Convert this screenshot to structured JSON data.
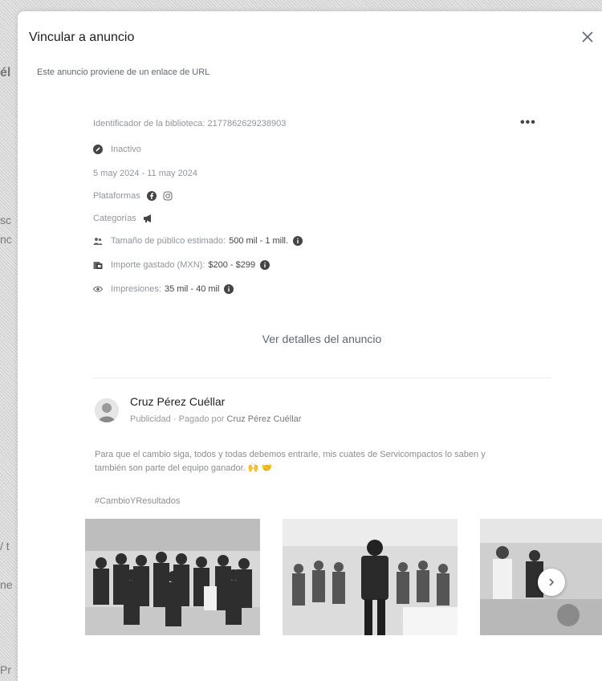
{
  "background": {
    "fragments": [
      "él",
      "sc",
      "nc",
      "/ t",
      "ne",
      "Pr"
    ]
  },
  "modal": {
    "title": "Vincular a anuncio",
    "subtitle": "Este anuncio proviene de un enlace de URL"
  },
  "ad": {
    "library_id_label": "Identificador de la biblioteca: 2177862629238903",
    "status": "Inactivo",
    "date_range": "5 may 2024 - 11 may 2024",
    "platforms_label": "Plataformas",
    "platform_icons": [
      "facebook-icon",
      "instagram-icon"
    ],
    "categories_label": "Categorías",
    "audience_label": "Tamaño de público estimado:",
    "audience_value": "500 mil - 1 mill.",
    "spend_label": "Importe gastado (MXN):",
    "spend_value": "$200 - $299",
    "impressions_label": "Impresiones:",
    "impressions_value": "35 mil - 40 mil",
    "details_button": "Ver detalles del anuncio",
    "page_name": "Cruz Pérez Cuéllar",
    "sponsored": "Publicidad",
    "paid_by_label": "Pagado por",
    "paid_by_name": "Cruz Pérez Cuéllar",
    "body_text": "Para que el cambio siga, todos y todas debemos entrarle, mis cuates de Servicompactos lo saben y también son parte del equipo ganador. 🙌 🤝",
    "hashtag": "#CambioYResultados"
  }
}
